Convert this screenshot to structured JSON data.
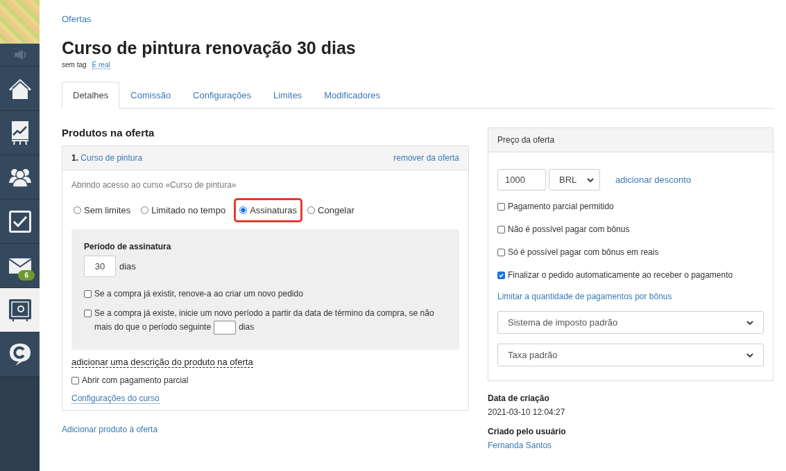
{
  "sidebar": {
    "items": [
      {
        "kind": "banner"
      },
      {
        "kind": "speaker",
        "selected": false
      },
      {
        "kind": "home",
        "selected": false
      },
      {
        "kind": "chart",
        "selected": false
      },
      {
        "kind": "users",
        "selected": false
      },
      {
        "kind": "tasks",
        "selected": false
      },
      {
        "kind": "mail",
        "selected": false,
        "badge": "6"
      },
      {
        "kind": "safe",
        "selected": true
      },
      {
        "kind": "chat",
        "selected": false
      }
    ]
  },
  "breadcrumb": "Ofertas",
  "title": "Curso de pintura renovação 30 dias",
  "tag": "sem tag",
  "tag_link": "É real",
  "tabs": [
    {
      "label": "Detalhes",
      "selected": true
    },
    {
      "label": "Comissão",
      "selected": false
    },
    {
      "label": "Configurações",
      "selected": false
    },
    {
      "label": "Limites",
      "selected": false
    },
    {
      "label": "Modificadores",
      "selected": false
    }
  ],
  "products": {
    "heading": "Produtos na oferta",
    "items": [
      {
        "number": "1.",
        "name": "Curso de pintura",
        "remove": "remover da oferta",
        "access_text": "Abrindo acesso ao curso «Curso de pintura»",
        "access_options": [
          {
            "label": "Sem limites",
            "selected": false,
            "highlighted": false
          },
          {
            "label": "Limitado no tempo",
            "selected": false,
            "highlighted": false
          },
          {
            "label": "Assinaturas",
            "selected": true,
            "highlighted": true
          },
          {
            "label": "Congelar",
            "selected": false,
            "highlighted": false
          }
        ],
        "subscription": {
          "heading": "Período de assinatura",
          "period": "30",
          "unit": "dias",
          "options": [
            {
              "label": "Se a compra já existir, renove-a ao criar um novo pedido",
              "checked": false
            },
            {
              "label": "Se a compra já existe, inicie um novo período a partir da data de término da compra, se não mais do que o período seguinte",
              "checked": false,
              "unit": "dias"
            }
          ]
        },
        "description_link": "adicionar uma descrição do produto na oferta",
        "partial": {
          "label": "Abrir com pagamento parcial",
          "checked": false
        },
        "settings_link": "Configurações do curso"
      }
    ],
    "add_link": "Adicionar produto à oferta"
  },
  "price": {
    "heading": "Preço da oferta",
    "amount": "1000",
    "currency": "BRL",
    "discount_link": "adicionar desconto",
    "options": [
      {
        "label": "Pagamento parcial permitido",
        "checked": false
      },
      {
        "label": "Não é possível pagar com bônus",
        "checked": false
      },
      {
        "label": "Só é possível pagar com bônus em reais",
        "checked": false
      },
      {
        "label": "Finalizar o pedido automaticamente ao receber o pagamento",
        "checked": true
      }
    ],
    "bonus_link": "Limitar a quantidade de pagamentos por bônus",
    "tax_system": "Sistema de imposto padrão",
    "tax_rate": "Taxa padrão"
  },
  "meta": [
    {
      "label": "Data de criação",
      "value": "2021-03-10 12:04:27",
      "kind": "text"
    },
    {
      "label": "Criado pelo usuário",
      "value": "Fernanda Santos",
      "kind": "link"
    }
  ]
}
